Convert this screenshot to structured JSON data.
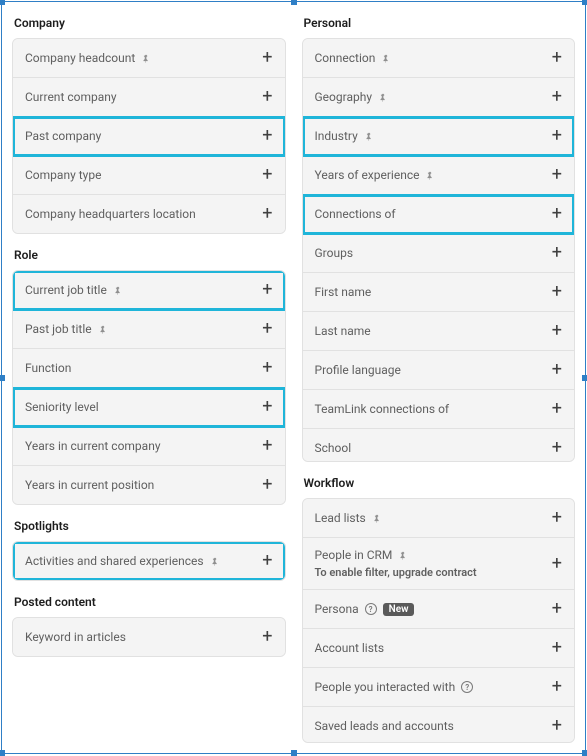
{
  "sections": {
    "company": {
      "title": "Company",
      "items": [
        {
          "label": "Company headcount",
          "pin": true,
          "highlight": false
        },
        {
          "label": "Current company",
          "pin": false,
          "highlight": false
        },
        {
          "label": "Past company",
          "pin": false,
          "highlight": true
        },
        {
          "label": "Company type",
          "pin": false,
          "highlight": false
        },
        {
          "label": "Company headquarters location",
          "pin": false,
          "highlight": false
        }
      ]
    },
    "role": {
      "title": "Role",
      "items": [
        {
          "label": "Current job title",
          "pin": true,
          "highlight": true
        },
        {
          "label": "Past job title",
          "pin": true,
          "highlight": false
        },
        {
          "label": "Function",
          "pin": false,
          "highlight": false
        },
        {
          "label": "Seniority level",
          "pin": false,
          "highlight": true
        },
        {
          "label": "Years in current company",
          "pin": false,
          "highlight": false
        },
        {
          "label": "Years in current position",
          "pin": false,
          "highlight": false
        }
      ]
    },
    "spotlights": {
      "title": "Spotlights",
      "items": [
        {
          "label": "Activities and shared experiences",
          "pin": true,
          "highlight": true
        }
      ]
    },
    "posted": {
      "title": "Posted content",
      "items": [
        {
          "label": "Keyword in articles",
          "pin": false,
          "highlight": false
        }
      ]
    },
    "personal": {
      "title": "Personal",
      "items": [
        {
          "label": "Connection",
          "pin": true,
          "highlight": false
        },
        {
          "label": "Geography",
          "pin": true,
          "highlight": false
        },
        {
          "label": "Industry",
          "pin": true,
          "highlight": true
        },
        {
          "label": "Years of experience",
          "pin": true,
          "highlight": false
        },
        {
          "label": "Connections of",
          "pin": false,
          "highlight": true
        },
        {
          "label": "Groups",
          "pin": false,
          "highlight": false
        },
        {
          "label": "First name",
          "pin": false,
          "highlight": false
        },
        {
          "label": "Last name",
          "pin": false,
          "highlight": false
        },
        {
          "label": "Profile language",
          "pin": false,
          "highlight": false
        },
        {
          "label": "TeamLink connections of",
          "pin": false,
          "highlight": false
        },
        {
          "label": "School",
          "pin": false,
          "highlight": false
        }
      ]
    },
    "workflow": {
      "title": "Workflow",
      "items": [
        {
          "label": "Lead lists",
          "pin": true,
          "highlight": false
        },
        {
          "label": "People in CRM",
          "pin": true,
          "highlight": false,
          "sub": "To enable filter, upgrade contract"
        },
        {
          "label": "Persona",
          "pin": false,
          "highlight": false,
          "help": true,
          "badge": "New"
        },
        {
          "label": "Account lists",
          "pin": false,
          "highlight": false
        },
        {
          "label": "People you interacted with",
          "pin": false,
          "highlight": false,
          "help": true
        },
        {
          "label": "Saved leads and accounts",
          "pin": false,
          "highlight": false
        }
      ]
    }
  }
}
